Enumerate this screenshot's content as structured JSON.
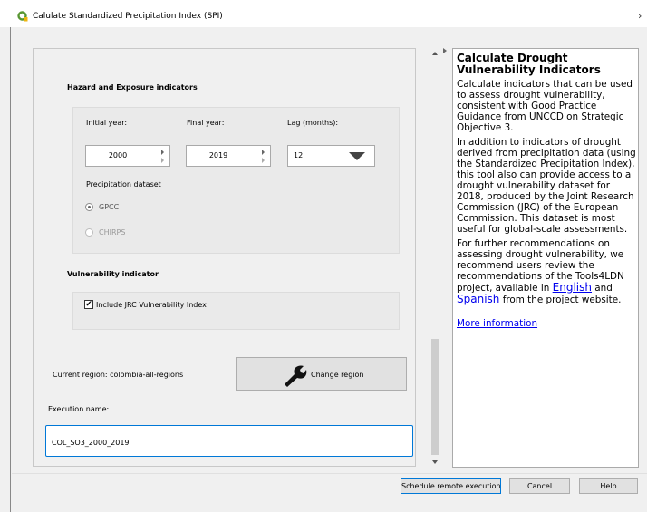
{
  "window": {
    "title": "Calulate Standardized Precipitation Index (SPI)",
    "close_glyph": "›"
  },
  "hazard": {
    "section_title": "Hazard and Exposure indicators",
    "initial_year_label": "Initial year:",
    "final_year_label": "Final year:",
    "lag_label": "Lag (months):",
    "initial_year": "2000",
    "final_year": "2019",
    "lag_value": "12",
    "dataset_label": "Precipitation dataset",
    "datasets": [
      {
        "label": "GPCC",
        "selected": true
      },
      {
        "label": "CHIRPS",
        "selected": false
      }
    ]
  },
  "vulnerability": {
    "section_title": "Vulnerability indicator",
    "checkbox_label": "Include JRC Vulnerability Index",
    "checked": true,
    "check_glyph": "✔"
  },
  "region": {
    "label": "Current region: colombia-all-regions",
    "button_label": "Change region"
  },
  "execution": {
    "label": "Execution name:",
    "value": "COL_SO3_2000_2019"
  },
  "help": {
    "title": "Calculate Drought Vulnerability Indicators",
    "p1": "Calculate indicators that can be used to assess drought vulnerability, consistent with Good Practice Guidance from UNCCD on Strategic Objective 3.",
    "p2": "In addition to indicators of drought derived from precipitation data (using the Standardized Precipitation Index), this tool also can provide access to a drought vulnerability dataset for 2018, produced by the Joint Research Commission (JRC) of the European Commission. This dataset is most useful for global-scale assessments.",
    "p3_before": "For further recommendations on assessing drought vulnerability, we recommend users review the recommendations of the Tools4LDN project, available in ",
    "link_english": "English",
    "p3_middle": " and ",
    "link_spanish": "Spanish",
    "p3_after": " from the project website.",
    "more_info": "More information"
  },
  "buttons": {
    "schedule": "Schedule remote execution",
    "cancel": "Cancel",
    "help": "Help"
  },
  "colors": {
    "accent": "#0078d7",
    "link": "#0000ee",
    "qgis_green": "#589632"
  }
}
